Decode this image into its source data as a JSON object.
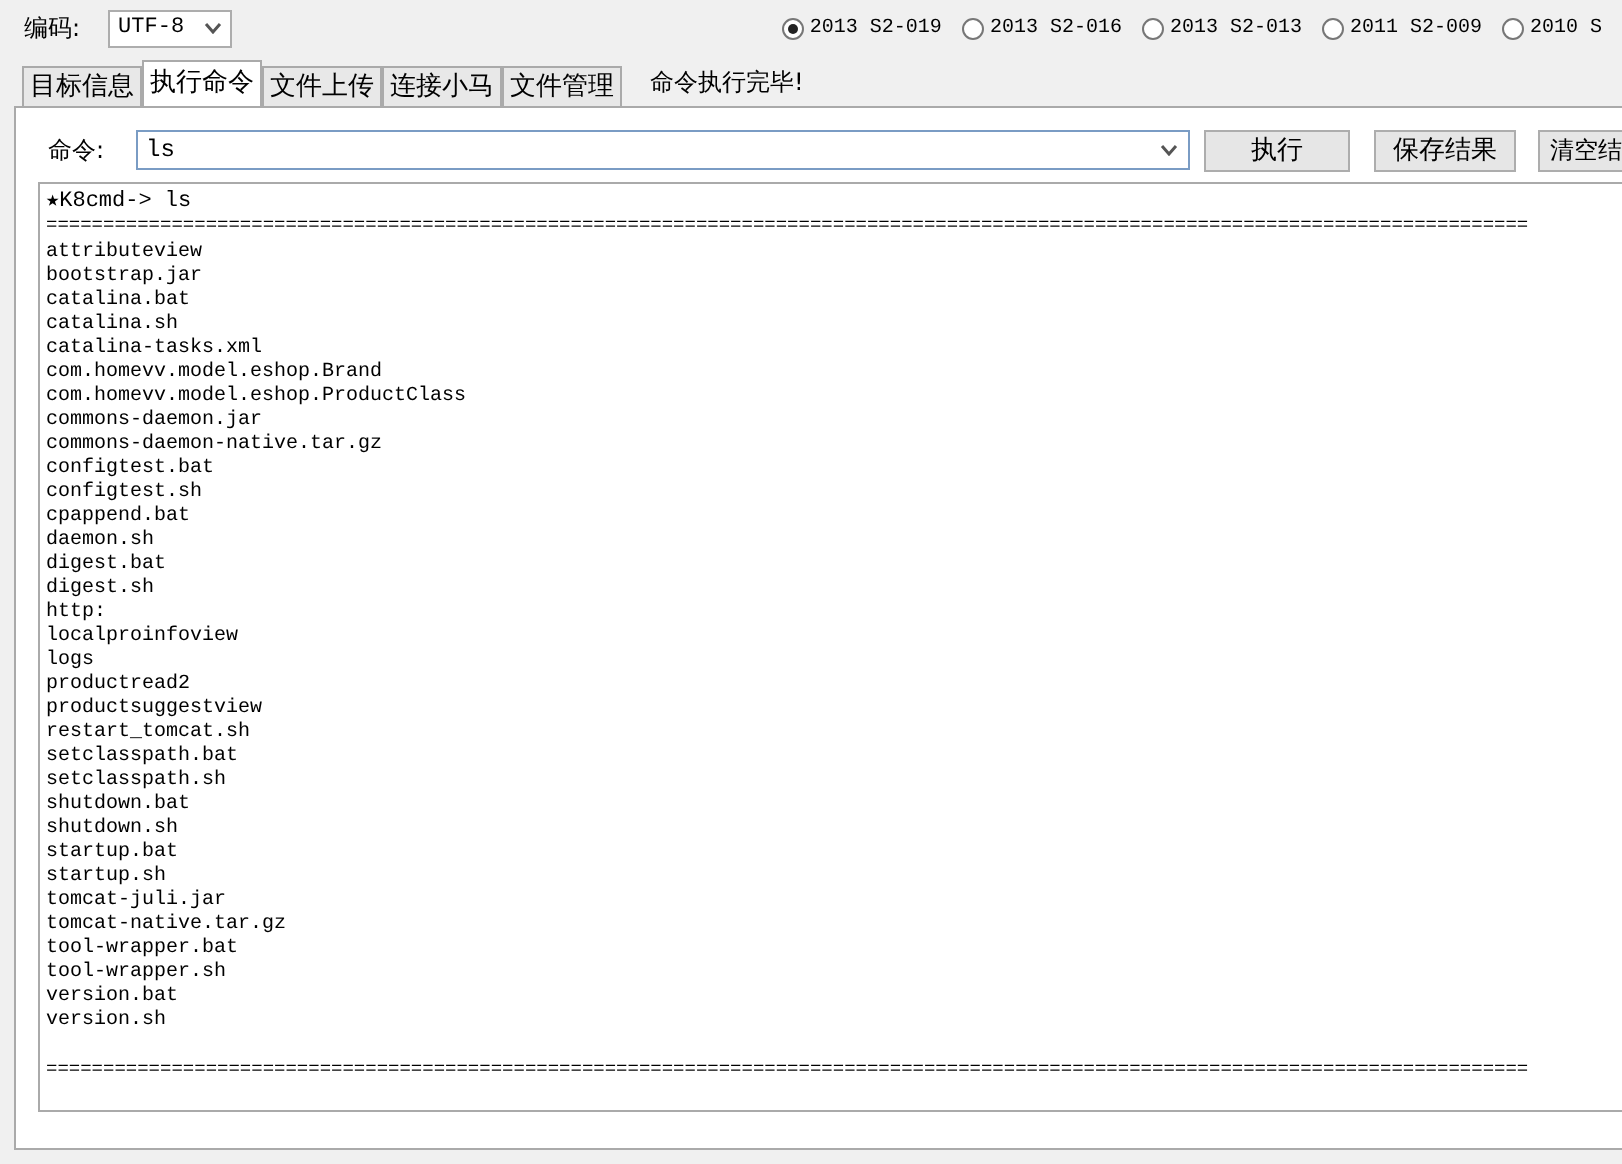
{
  "encoding": {
    "label": "编码:",
    "value": "UTF-8"
  },
  "versions": [
    {
      "label": "2013 S2-019",
      "selected": true
    },
    {
      "label": "2013 S2-016",
      "selected": false
    },
    {
      "label": "2013 S2-013",
      "selected": false
    },
    {
      "label": "2011 S2-009",
      "selected": false
    },
    {
      "label": "2010 S",
      "selected": false
    }
  ],
  "tabs": [
    {
      "label": "目标信息",
      "selected": false
    },
    {
      "label": "执行命令",
      "selected": true
    },
    {
      "label": "文件上传",
      "selected": false
    },
    {
      "label": "连接小马",
      "selected": false
    },
    {
      "label": "文件管理",
      "selected": false
    }
  ],
  "status": "命令执行完毕!",
  "command": {
    "label": "命令:",
    "value": "ls"
  },
  "buttons": [
    "执行",
    "保存结果",
    "清空结"
  ],
  "output": {
    "prompt": "★K8cmd-> ls",
    "separator": "==================================================================================================================================",
    "lines": [
      "attributeview",
      "bootstrap.jar",
      "catalina.bat",
      "catalina.sh",
      "catalina-tasks.xml",
      "com.homevv.model.eshop.Brand",
      "com.homevv.model.eshop.ProductClass",
      "commons-daemon.jar",
      "commons-daemon-native.tar.gz",
      "configtest.bat",
      "configtest.sh",
      "cpappend.bat",
      "daemon.sh",
      "digest.bat",
      "digest.sh",
      "http:",
      "localproinfoview",
      "logs",
      "productread2",
      "productsuggestview",
      "restart_tomcat.sh",
      "setclasspath.bat",
      "setclasspath.sh",
      "shutdown.bat",
      "shutdown.sh",
      "startup.bat",
      "startup.sh",
      "tomcat-juli.jar",
      "tomcat-native.tar.gz",
      "tool-wrapper.bat",
      "tool-wrapper.sh",
      "version.bat",
      "version.sh"
    ],
    "end_separator": "=================================================================================================================================="
  }
}
